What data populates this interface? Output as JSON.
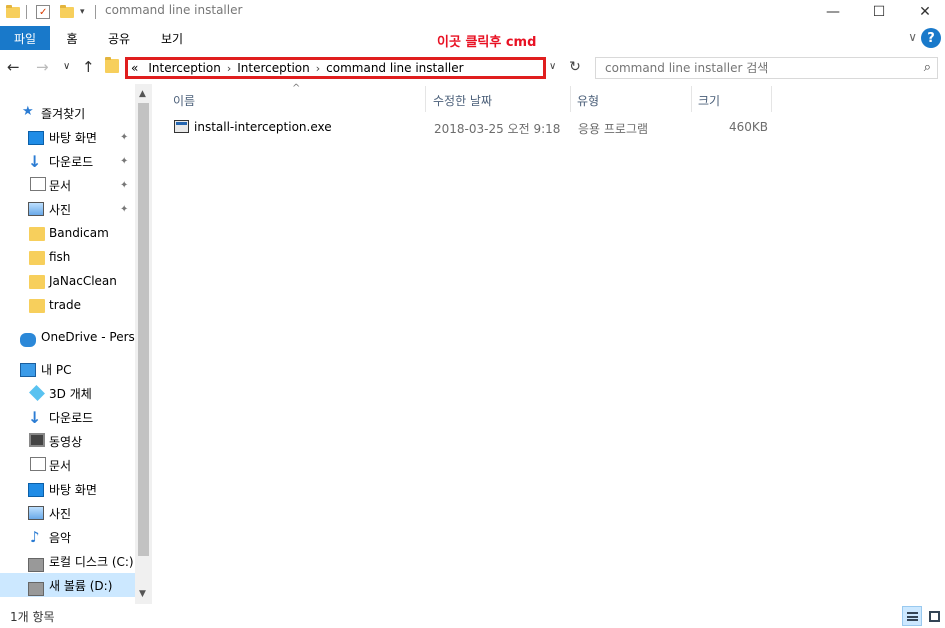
{
  "window": {
    "title": "command line installer",
    "controls": {
      "minimize": "—",
      "maximize": "☐",
      "close": "✕"
    }
  },
  "ribbon": {
    "tabs": [
      "파일",
      "홈",
      "공유",
      "보기"
    ],
    "annotation": "이곳 클릭후 cmd",
    "help_icon": "?",
    "chevron": "∨"
  },
  "nav": {
    "back": "←",
    "forward": "→",
    "recent": "∨",
    "up": "↑"
  },
  "address": {
    "lead": "«",
    "crumbs": [
      "Interception",
      "Interception",
      "command line installer"
    ],
    "separator": "›",
    "dropdown": "∨",
    "refresh": "↻"
  },
  "search": {
    "placeholder": "command line installer 검색",
    "icon": "⌕"
  },
  "sidebar": {
    "quick_access": "즐겨찾기",
    "items": [
      {
        "label": "바탕 화면",
        "icon": "desktop-icon",
        "pinned": true
      },
      {
        "label": "다운로드",
        "icon": "download-icon",
        "pinned": true
      },
      {
        "label": "문서",
        "icon": "document-icon",
        "pinned": true
      },
      {
        "label": "사진",
        "icon": "pictures-icon",
        "pinned": true
      },
      {
        "label": "Bandicam",
        "icon": "folder-icon",
        "pinned": false
      },
      {
        "label": "fish",
        "icon": "folder-icon",
        "pinned": false
      },
      {
        "label": "JaNacClean",
        "icon": "folder-icon",
        "pinned": false
      },
      {
        "label": "trade",
        "icon": "folder-icon",
        "pinned": false
      }
    ],
    "onedrive": "OneDrive - Perso",
    "this_pc": "내 PC",
    "pc_items": [
      {
        "label": "3D 개체",
        "icon": "3d-objects-icon"
      },
      {
        "label": "다운로드",
        "icon": "download-icon"
      },
      {
        "label": "동영상",
        "icon": "video-icon"
      },
      {
        "label": "문서",
        "icon": "document-icon"
      },
      {
        "label": "바탕 화면",
        "icon": "desktop-icon"
      },
      {
        "label": "사진",
        "icon": "pictures-icon"
      },
      {
        "label": "음악",
        "icon": "music-icon"
      },
      {
        "label": "로컬 디스크 (C:)",
        "icon": "drive-icon"
      },
      {
        "label": "새 볼륨 (D:)",
        "icon": "drive-icon",
        "selected": true
      }
    ],
    "pin_glyph": "📌"
  },
  "columns": {
    "name": "이름",
    "modified": "수정한 날짜",
    "type": "유형",
    "size": "크기"
  },
  "files": [
    {
      "name": "install-interception.exe",
      "modified": "2018-03-25 오전 9:18",
      "type": "응용 프로그램",
      "size": "460KB"
    }
  ],
  "status": {
    "count": "1개 항목"
  }
}
